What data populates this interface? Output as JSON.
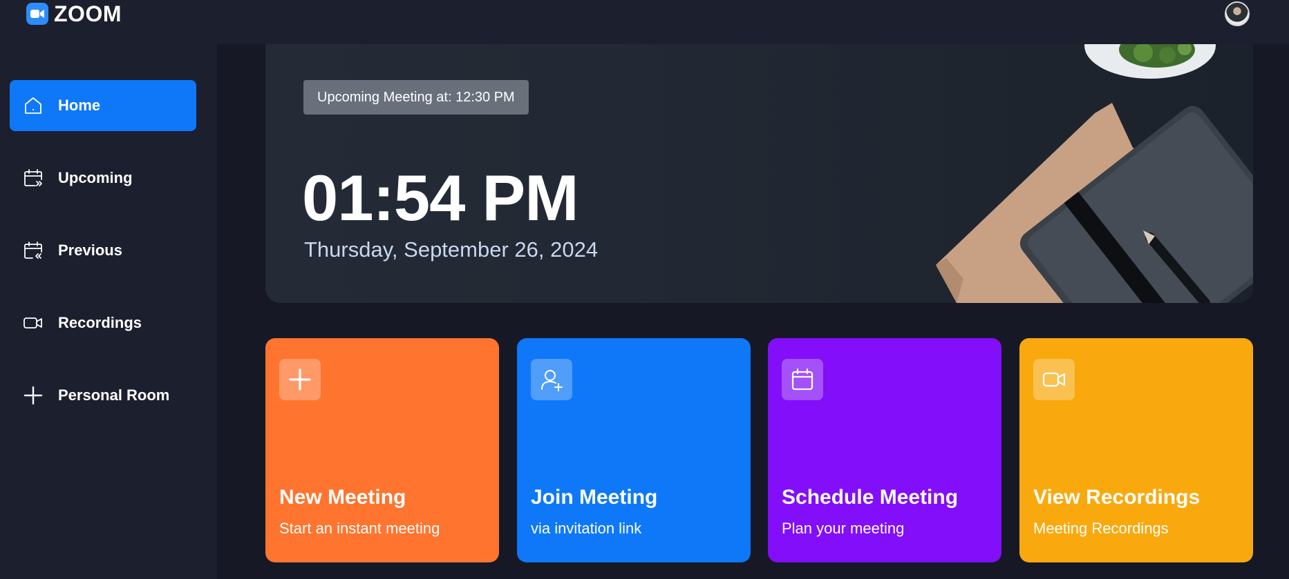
{
  "app": {
    "title": "ZOOM"
  },
  "colors": {
    "accent": "#0e78f9",
    "card_new": "#ff742e",
    "card_join": "#0e78f9",
    "card_schedule": "#830ef9",
    "card_recordings": "#f9a90e",
    "background": "#161925",
    "panel": "#1c1f2e"
  },
  "sidebar": {
    "items": [
      {
        "label": "Home",
        "icon": "home-icon",
        "active": true
      },
      {
        "label": "Upcoming",
        "icon": "calendar-upcoming-icon",
        "active": false
      },
      {
        "label": "Previous",
        "icon": "calendar-previous-icon",
        "active": false
      },
      {
        "label": "Recordings",
        "icon": "video-icon",
        "active": false
      },
      {
        "label": "Personal Room",
        "icon": "plus-icon",
        "active": false
      }
    ]
  },
  "hero": {
    "badge": "Upcoming Meeting at: 12:30 PM",
    "time": "01:54 PM",
    "date": "Thursday, September 26, 2024"
  },
  "cards": [
    {
      "title": "New Meeting",
      "subtitle": "Start an instant meeting",
      "icon": "plus-icon"
    },
    {
      "title": "Join Meeting",
      "subtitle": "via invitation link",
      "icon": "user-add-icon"
    },
    {
      "title": "Schedule Meeting",
      "subtitle": "Plan your meeting",
      "icon": "calendar-icon"
    },
    {
      "title": "View Recordings",
      "subtitle": "Meeting Recordings",
      "icon": "video-icon"
    }
  ]
}
